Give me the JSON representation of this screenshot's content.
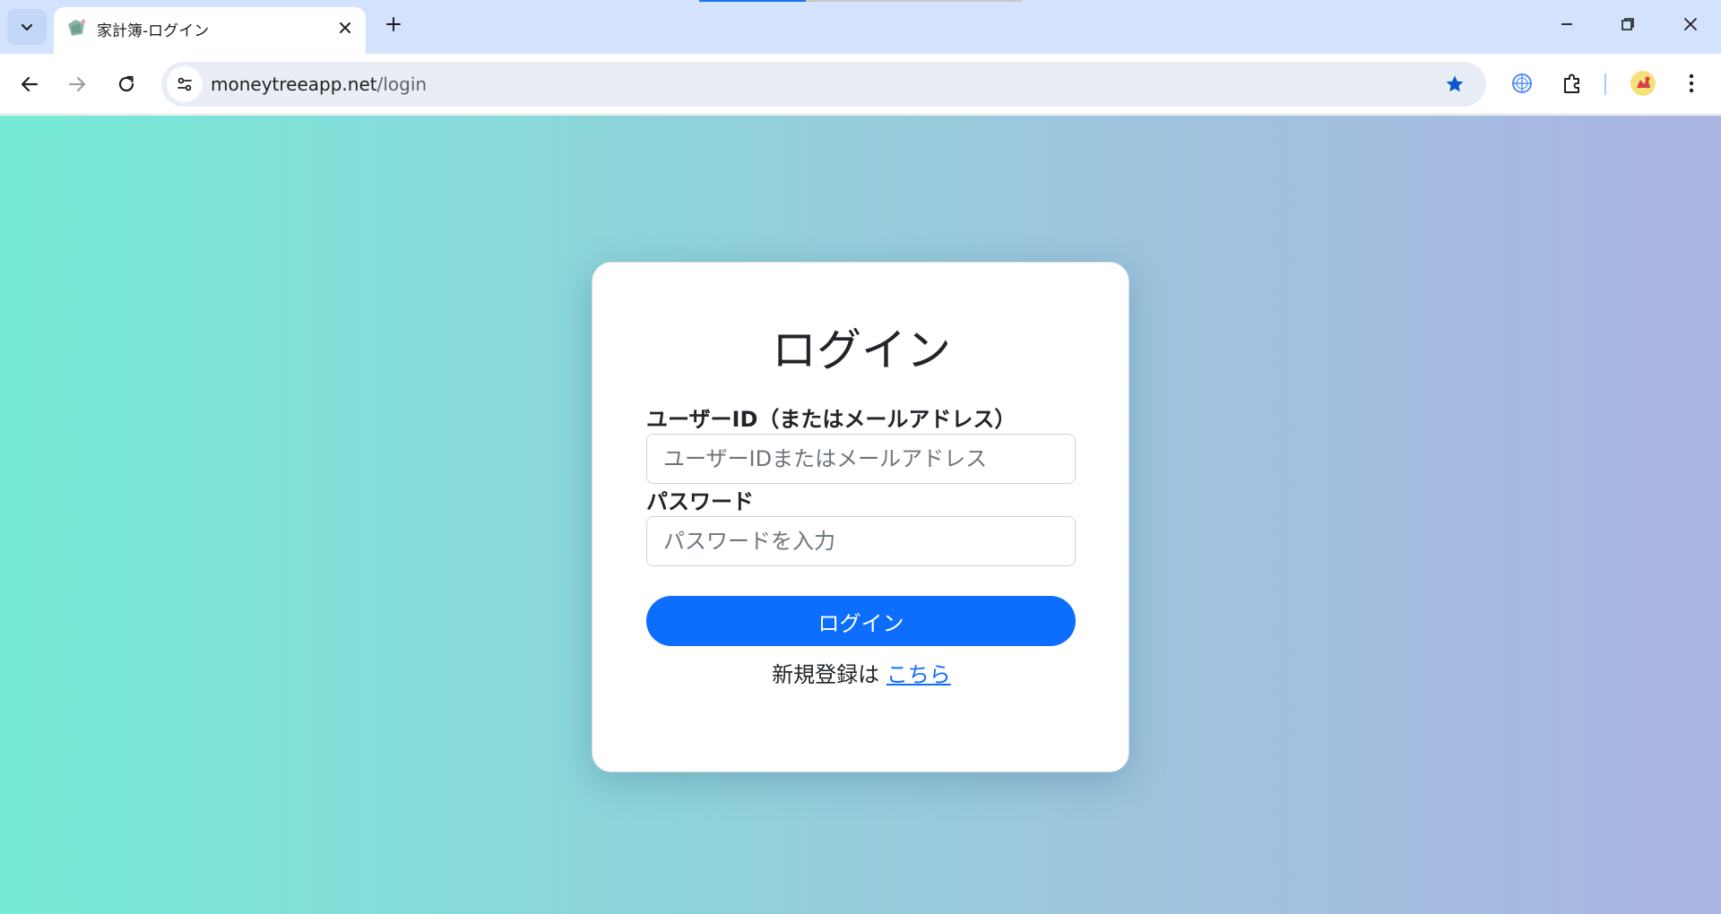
{
  "browser": {
    "tab": {
      "title": "家計簿-ログイン",
      "loading_progress": 0.33
    },
    "address_bar": {
      "host": "moneytreeapp.net",
      "path": "/login"
    },
    "icons": {
      "tab_search": "chevron-down-icon",
      "favicon": "wallet-favicon",
      "close_tab": "close-icon",
      "new_tab": "plus-icon",
      "minimize": "minimize-icon",
      "restore": "restore-icon",
      "close_window": "close-icon",
      "back": "arrow-left-icon",
      "forward": "arrow-right-icon",
      "reload": "reload-icon",
      "site_info": "tune-icon",
      "bookmark": "star-icon",
      "extension_1": "globe-extension-icon",
      "extensions": "puzzle-icon",
      "profile": "profile-avatar-icon",
      "menu": "kebab-menu-icon"
    },
    "colors": {
      "tabstrip": "#d3e3fd",
      "omnibox": "#e9eef6",
      "bookmark_star": "#0b57d0"
    }
  },
  "login": {
    "title": "ログイン",
    "user_id": {
      "label": "ユーザーID（またはメールアドレス）",
      "value": "",
      "placeholder": "ユーザーIDまたはメールアドレス"
    },
    "password": {
      "label": "パスワード",
      "value": "",
      "placeholder": "パスワードを入力"
    },
    "submit_label": "ログイン",
    "register": {
      "prefix": "新規登録は",
      "link_text": "こちら"
    }
  },
  "colors": {
    "primary": "#0d6efd",
    "gradient_start": "#76ead7",
    "gradient_end": "#abb5e3"
  }
}
